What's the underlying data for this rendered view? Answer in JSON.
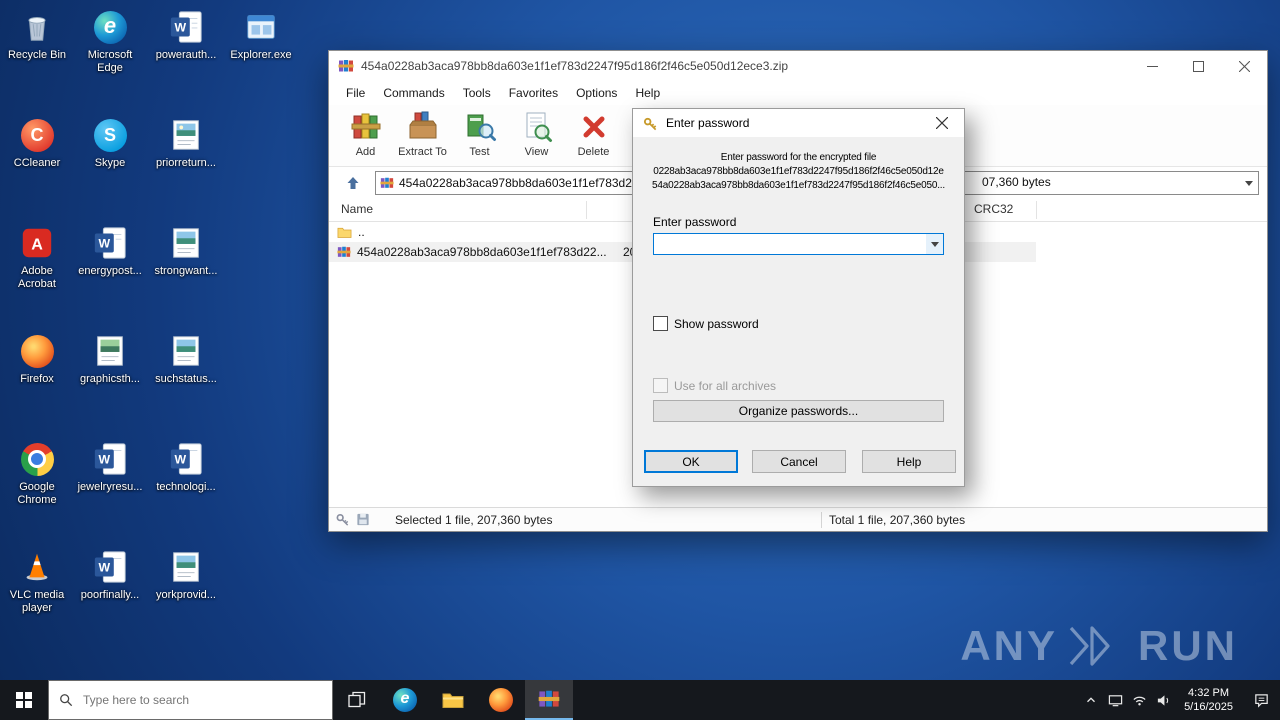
{
  "colors": {
    "accent": "#0078d7",
    "selection_row": "#f1f1f1",
    "taskbar": "#15181d",
    "desktop_blue": "#1f55a4"
  },
  "desktop": {
    "icons": [
      {
        "label": "Recycle Bin",
        "icon": "recycle-bin-icon"
      },
      {
        "label": "Microsoft Edge",
        "icon": "edge-icon"
      },
      {
        "label": "powerauth...",
        "icon": "word-doc-icon"
      },
      {
        "label": "Explorer.exe",
        "icon": "app-window-icon"
      },
      {
        "label": "CCleaner",
        "icon": "ccleaner-icon"
      },
      {
        "label": "Skype",
        "icon": "skype-icon"
      },
      {
        "label": "priorreturn...",
        "icon": "picture-file-icon"
      },
      {
        "label": "Adobe Acrobat",
        "icon": "acrobat-icon"
      },
      {
        "label": "energypost...",
        "icon": "word-doc-icon"
      },
      {
        "label": "strongwant...",
        "icon": "picture-file-icon"
      },
      {
        "label": "Firefox",
        "icon": "firefox-icon"
      },
      {
        "label": "graphicsth...",
        "icon": "picture-file-icon"
      },
      {
        "label": "suchstatus...",
        "icon": "picture-file-icon"
      },
      {
        "label": "Google Chrome",
        "icon": "chrome-icon"
      },
      {
        "label": "jewelryresu...",
        "icon": "word-doc-icon"
      },
      {
        "label": "technologi...",
        "icon": "word-doc-icon"
      },
      {
        "label": "VLC media player",
        "icon": "vlc-icon"
      },
      {
        "label": "poorfinally...",
        "icon": "word-doc-icon"
      },
      {
        "label": "yorkprovid...",
        "icon": "picture-file-icon"
      }
    ],
    "watermark": {
      "left": "ANY",
      "right": "RUN"
    }
  },
  "winrar": {
    "title": "454a0228ab3aca978bb8da603e1f1ef783d2247f95d186f2f46c5e050d12ece3.zip",
    "menu": [
      "File",
      "Commands",
      "Tools",
      "Favorites",
      "Options",
      "Help"
    ],
    "toolbar": [
      "Add",
      "Extract To",
      "Test",
      "View",
      "Delete"
    ],
    "address": "454a0228ab3aca978bb8da603e1f1ef783d2247f95d186f2f46c5e050d12ece3.zip",
    "address_extra": "07,360 bytes",
    "columns": {
      "name": "Name",
      "crc": "CRC32"
    },
    "rows": [
      {
        "name": ".."
      },
      {
        "name": "454a0228ab3aca978bb8da603e1f1ef783d22...",
        "size": "207,360"
      }
    ],
    "status": {
      "selected": "Selected 1 file, 207,360 bytes",
      "total": "Total 1 file, 207,360 bytes"
    }
  },
  "dialog": {
    "title": "Enter password",
    "info_line1": "Enter password for the encrypted file",
    "info_line2": "0228ab3aca978bb8da603e1f1ef783d2247f95d186f2f46c5e050d12e",
    "info_line3": "54a0228ab3aca978bb8da603e1f1ef783d2247f95d186f2f46c5e050...",
    "label": "Enter password",
    "show_password": "Show password",
    "use_all": "Use for all archives",
    "organize": "Organize passwords...",
    "ok": "OK",
    "cancel": "Cancel",
    "help": "Help"
  },
  "taskbar": {
    "search_placeholder": "Type here to search",
    "time": "4:32 PM",
    "date": "5/16/2025"
  }
}
